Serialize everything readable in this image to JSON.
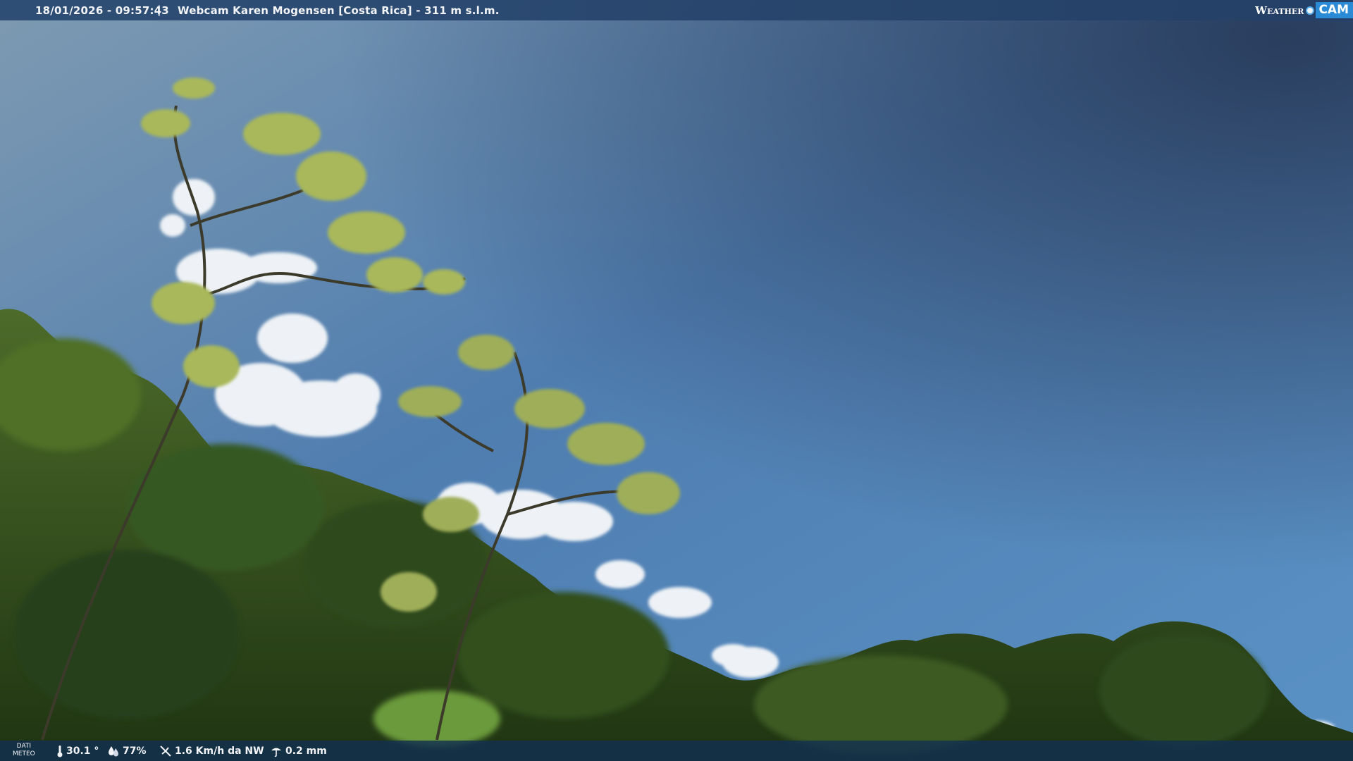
{
  "header": {
    "timestamp": "18/01/2026 - 09:57:43",
    "separator": "|",
    "title": "Webcam Karen Mogensen [Costa Rica] - 311 m s.l.m.",
    "brand_weather": "Weather",
    "brand_cam": "CAM"
  },
  "footer": {
    "dati_line1": "DATI",
    "dati_line2": "METEO",
    "temperature": "30.1 °",
    "humidity": "77%",
    "wind": "1.6 Km/h da NW",
    "rain": "0.2 mm"
  },
  "icons": [
    "thermometer-icon",
    "humidity-icon",
    "wind-icon",
    "rain-icon",
    "webcam-eye-icon"
  ],
  "colors": {
    "sky_top": "#6f8fab",
    "sky_right": "#33496e",
    "sky_low": "#5b8fc2",
    "foliage": "#2f4a1c",
    "brand_blue": "#2b8ad6"
  }
}
